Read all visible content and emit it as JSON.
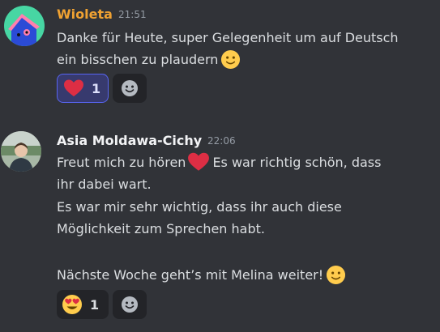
{
  "messages": [
    {
      "author": "Wioleta",
      "author_color": "#f0a232",
      "time": "21:51",
      "lines": [
        "Danke für Heute, super Gelegenheit um auf Deutsch",
        "ein bisschen zu plaudern"
      ],
      "reactions": [
        {
          "emoji": "red-heart",
          "count": "1",
          "active": true
        }
      ]
    },
    {
      "author": "Asia Moldawa-Cichy",
      "author_color": "#f2f3f5",
      "time": "22:06",
      "lines": [
        "Freut mich zu hören",
        "Es war richtig schön, dass",
        "ihr dabei wart.",
        "Es war mir sehr wichtig, dass ihr auch diese",
        "Möglichkeit zum Sprechen habt.",
        "Nächste Woche geht’s mit Melina weiter!"
      ],
      "reactions": [
        {
          "emoji": "heart-eyes",
          "count": "1",
          "active": false
        }
      ]
    }
  ]
}
